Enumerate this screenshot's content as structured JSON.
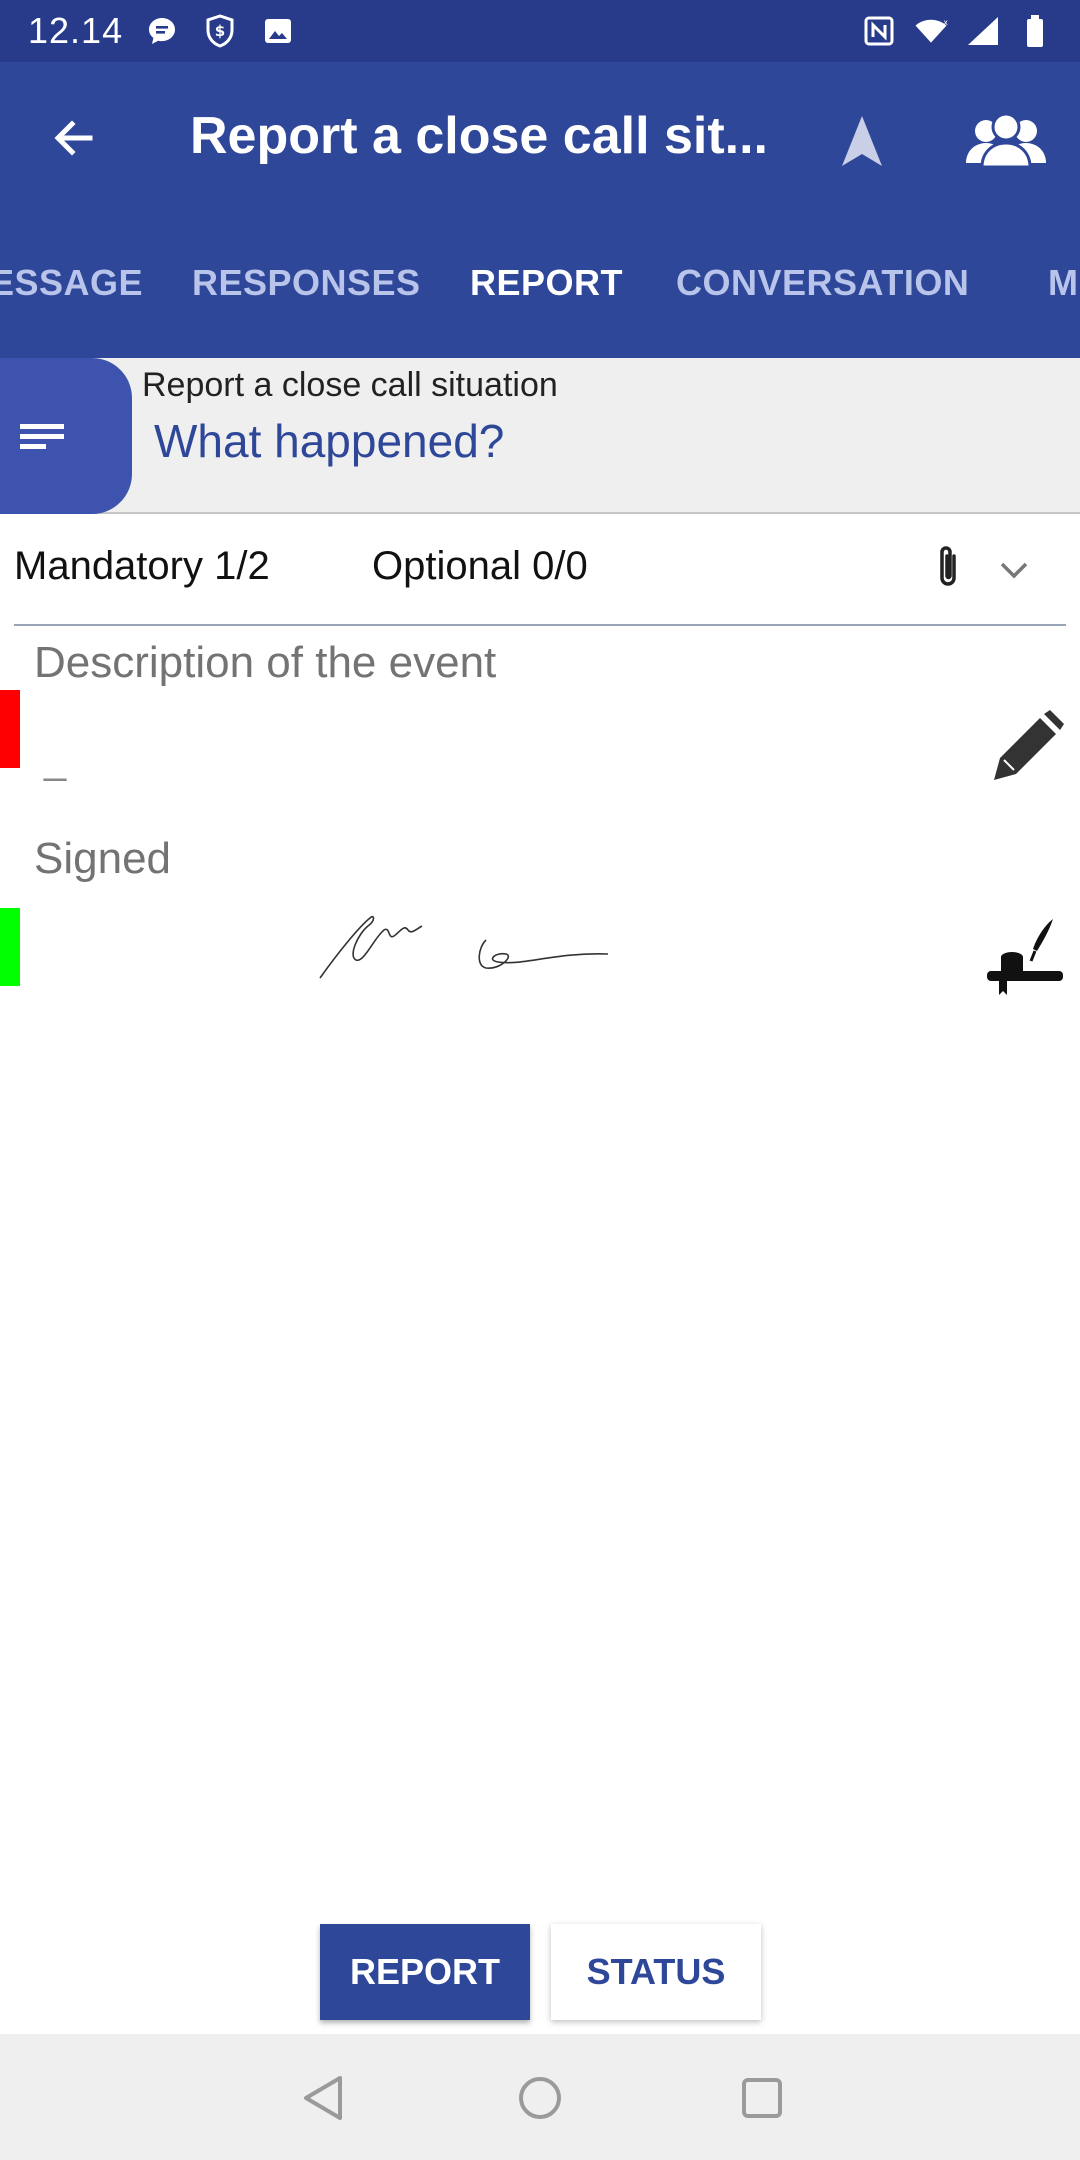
{
  "status_bar": {
    "time": "12.14",
    "icons_left": [
      "chat-bubble-icon",
      "shield-dollar-icon",
      "image-icon"
    ],
    "icons_right": [
      "nfc-icon",
      "wifi-icon",
      "signal-icon",
      "battery-icon"
    ]
  },
  "app_bar": {
    "title": "Report a close call sit...",
    "back_icon": "arrow-left-icon",
    "navigate_icon": "navigation-arrow-icon",
    "group_icon": "group-icon"
  },
  "tabs": [
    {
      "label": "ESSAGE",
      "active": false
    },
    {
      "label": "RESPONSES",
      "active": false
    },
    {
      "label": "REPORT",
      "active": true
    },
    {
      "label": "CONVERSATION",
      "active": false
    },
    {
      "label": "M",
      "active": false
    }
  ],
  "header": {
    "subtitle": "Report a close call situation",
    "question": "What happened?"
  },
  "counts": {
    "mandatory": "Mandatory 1/2",
    "optional": "Optional 0/0"
  },
  "fields": [
    {
      "label": "Description of the event",
      "value": "_",
      "status_color": "#ff0000",
      "edit_icon": "pen-icon"
    },
    {
      "label": "Signed",
      "value": "",
      "status_color": "#00ff00",
      "edit_icon": "signature-quill-icon"
    }
  ],
  "buttons": {
    "report": "REPORT",
    "status": "STATUS"
  },
  "colors": {
    "primary": "#2f4799",
    "status_bar": "#283b8a",
    "tab_inactive": "#b9c4ea",
    "mandatory_missing": "#ff0000",
    "mandatory_done": "#00ff00"
  }
}
